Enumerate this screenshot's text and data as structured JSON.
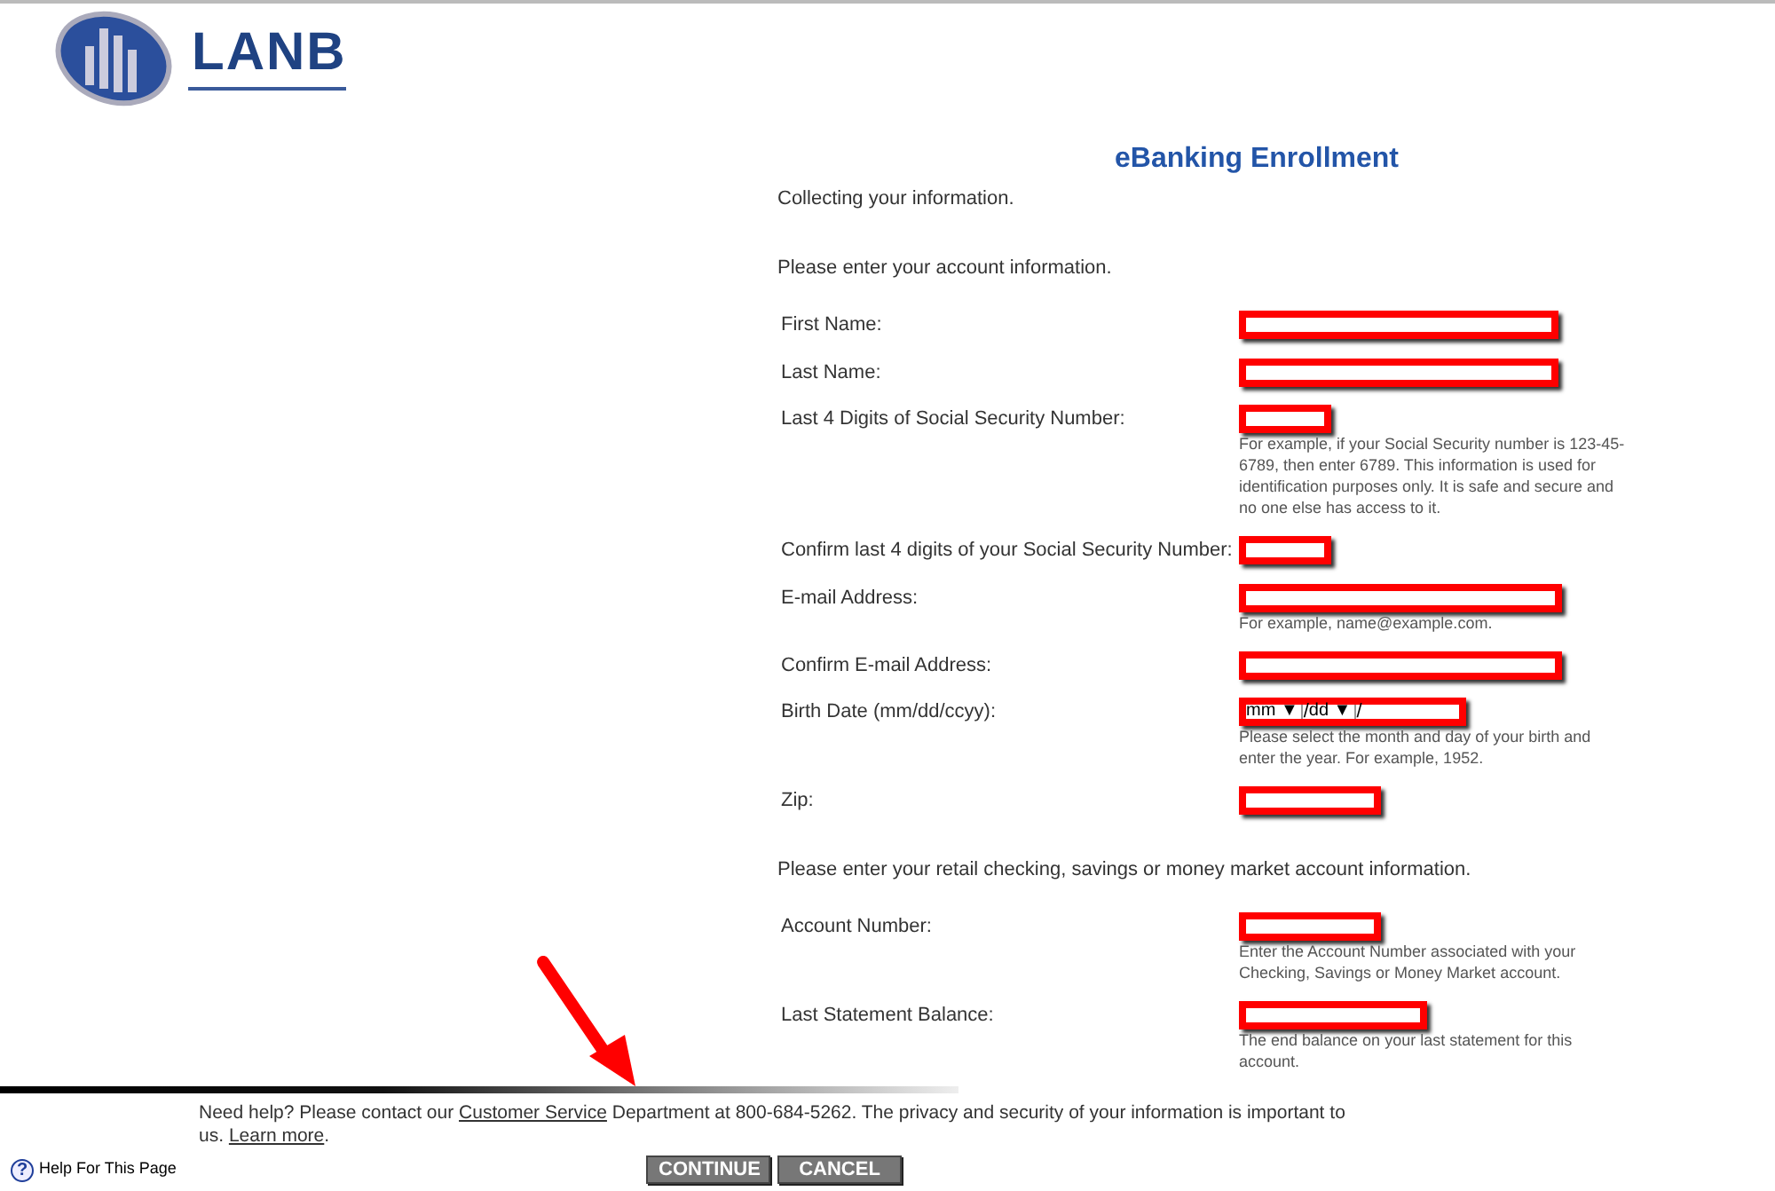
{
  "logo": {
    "text": "LANB"
  },
  "title": "eBanking Enrollment",
  "intro": "Collecting your information.",
  "sections": [
    {
      "heading": "Please enter your account information.",
      "fields": [
        {
          "kind": "text",
          "label": "First Name:"
        },
        {
          "kind": "text",
          "label": "Last Name:"
        },
        {
          "kind": "text",
          "label": "Last 4 Digits of Social Security Number:",
          "hint": "For example, if your Social Security number is 123-45-6789, then enter 6789. This information is used for identification purposes only. It is safe and secure and no one else has access to it."
        },
        {
          "kind": "text",
          "label": "Confirm last 4 digits of your Social Security Number:"
        },
        {
          "kind": "text",
          "label": "E-mail Address:",
          "hint": "For example, name@example.com."
        },
        {
          "kind": "text",
          "label": "Confirm E-mail Address:"
        },
        {
          "kind": "date",
          "label": "Birth Date (mm/dd/ccyy):",
          "month": "mm",
          "day": "dd",
          "dropdown_glyph": "▼",
          "separator": "/",
          "hint": "Please select the month and day of your birth and enter the year. For example, 1952."
        },
        {
          "kind": "text",
          "label": "Zip:"
        }
      ]
    },
    {
      "heading": "Please enter your retail checking, savings or money market account information.",
      "fields": [
        {
          "kind": "text",
          "label": "Account Number:",
          "hint": "Enter the Account Number associated with your Checking, Savings or Money Market account."
        },
        {
          "kind": "text",
          "label": "Last Statement Balance:",
          "hint": "The end balance on your last statement for this account."
        }
      ]
    }
  ],
  "footer": {
    "help_before": "Need help? Please contact our ",
    "help_link": "Customer Service",
    "help_middle": " Department at 800-684-5262. The privacy and security of your information is important to us. ",
    "learn_link": "Learn more",
    "help_after": ".",
    "page_help": {
      "glyph": "?",
      "label": "Help For This Page"
    },
    "buttons": [
      "CONTINUE",
      "CANCEL"
    ]
  }
}
